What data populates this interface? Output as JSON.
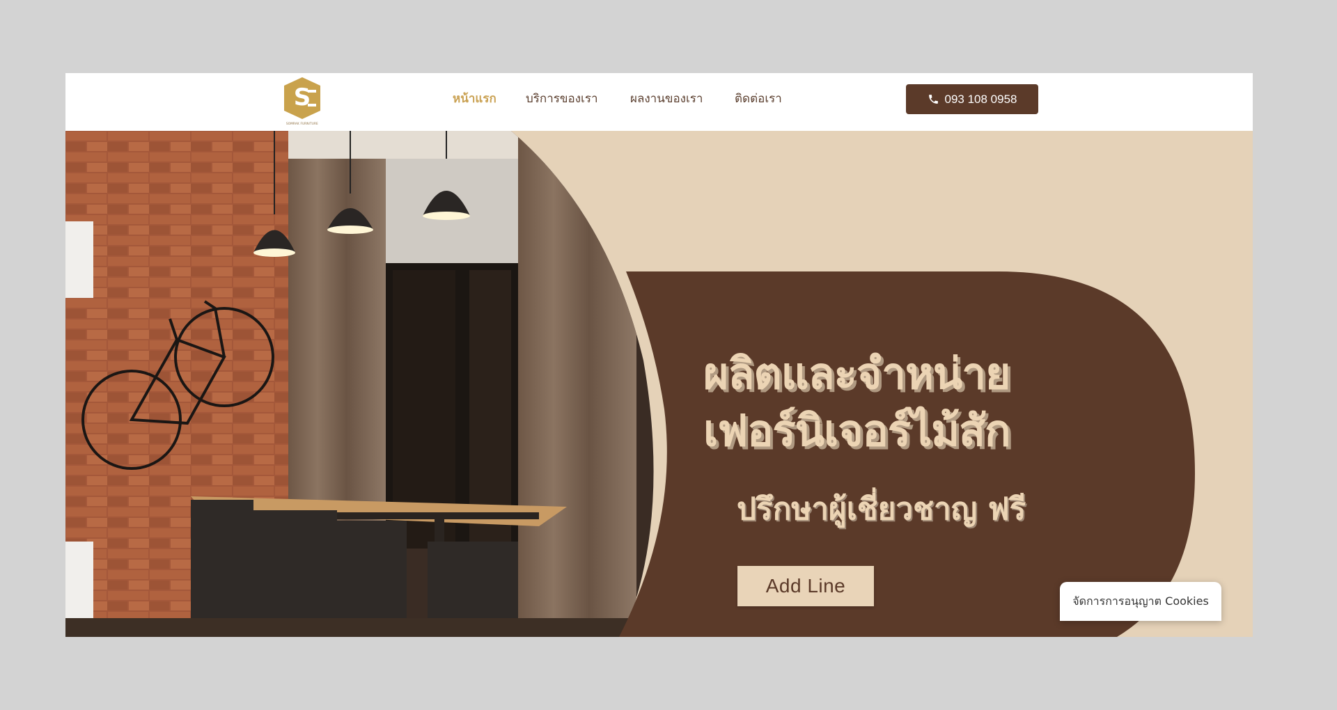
{
  "header": {
    "logo_alt": "SR logo",
    "logo_tagline": "SOMRAK FURNITURE",
    "nav": [
      {
        "label": "หน้าแรก",
        "active": true
      },
      {
        "label": "บริการของเรา",
        "active": false
      },
      {
        "label": "ผลงานของเรา",
        "active": false
      },
      {
        "label": "ติดต่อเรา",
        "active": false
      }
    ],
    "phone": "093 108 0958",
    "phone_icon": "phone-icon"
  },
  "hero": {
    "title_line1": "ผลิตและจำหน่าย",
    "title_line2": "เฟอร์นิเจอร์ไม้สัก",
    "subtitle": "ปรึกษาผู้เชี่ยวชาญ ฟรี",
    "cta_label": "Add Line"
  },
  "cookie": {
    "label": "จัดการการอนุญาต Cookies"
  },
  "colors": {
    "brand_brown": "#5b3a29",
    "accent_gold": "#caa254",
    "beige": "#e5d2b8"
  }
}
